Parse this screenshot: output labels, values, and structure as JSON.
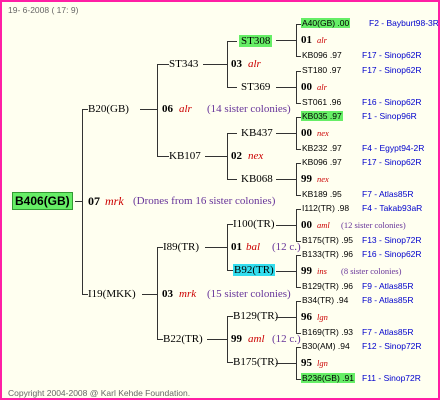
{
  "header": {
    "date_text": "19-  6-2008 ( 17: 9)"
  },
  "footer": {
    "copyright": "Copyright 2004-2008 @ Karl Kehde Foundation."
  },
  "root": {
    "label": "B406(GB)"
  },
  "gen1": {
    "sire": {
      "label": "B20(GB)"
    },
    "dam": {
      "label": "I19(MKK)"
    },
    "year": "07",
    "race": "mrk",
    "note": "(Drones from 16 sister colonies)"
  },
  "gen2": {
    "s": {
      "label": "ST343",
      "year": "03",
      "race": "alr"
    },
    "s_info": {
      "year": "06",
      "race": "alr",
      "note": "(14 sister colonies)"
    },
    "d": {
      "label": "KB107",
      "year": "02",
      "race": "nex"
    },
    "ds": {
      "label": "I89(TR)",
      "year": "01",
      "race": "bal",
      "note": "(12 c.)"
    },
    "ds_info": {
      "year": "03",
      "race": "mrk",
      "note": "(15 sister colonies)"
    },
    "dd": {
      "label": "B22(TR)",
      "year": "99",
      "race": "aml",
      "note": "(12 c.)"
    }
  },
  "gen3": {
    "ST308": "ST308",
    "ST369": "ST369",
    "KB437": "KB437",
    "KB068": "KB068",
    "I100": "I100(TR)",
    "B92": "B92(TR)",
    "B129": "B129(TR)",
    "B175": "B175(TR)"
  },
  "gen4": [
    {
      "top": "A40(GB) .00",
      "top_right": "F2 - Bayburt98-3R",
      "mid_year": "01",
      "mid_race": "alr",
      "bottom": "KB096 .97",
      "bottom_right": "F17 - Sinop62R"
    },
    {
      "top": "ST180 .97",
      "top_right": "F17 - Sinop62R",
      "mid_year": "00",
      "mid_race": "alr",
      "bottom": "ST061 .96",
      "bottom_right": "F16 - Sinop62R"
    },
    {
      "top": "KB035 .97",
      "top_right": "F1 - Sinop96R",
      "mid_year": "00",
      "mid_race": "nex",
      "bottom": "KB232 .97",
      "bottom_right": "F4 - Egypt94-2R"
    },
    {
      "top": "KB096 .97",
      "top_right": "F17 - Sinop62R",
      "mid_year": "99",
      "mid_race": "nex",
      "bottom": "KB189 .95",
      "bottom_right": "F7 - Atlas85R"
    },
    {
      "top": "I112(TR) .98",
      "top_right": "F4 - Takab93aR",
      "mid_year": "00",
      "mid_race": "aml",
      "mid_note": "(12 sister colonies)",
      "bottom": "B175(TR) .95",
      "bottom_right": "F13 - Sinop72R"
    },
    {
      "top": "B133(TR) .96",
      "top_right": "F16 - Sinop62R",
      "mid_year": "99",
      "mid_race": "ins",
      "mid_note": "(8 sister colonies)",
      "bottom": "B129(TR) .96",
      "bottom_right": "F9 - Atlas85R"
    },
    {
      "top": "B34(TR) .94",
      "top_right": "F8 - Atlas85R",
      "mid_year": "96",
      "mid_race": "lgn",
      "bottom": "B169(TR) .93",
      "bottom_right": "F7 - Atlas85R"
    },
    {
      "top": "B30(AM) .94",
      "top_right": "F12 - Sinop72R",
      "mid_year": "95",
      "mid_race": "lgn",
      "bottom": "B236(GB) .91",
      "bottom_right": "F11 - Sinop72R"
    }
  ]
}
